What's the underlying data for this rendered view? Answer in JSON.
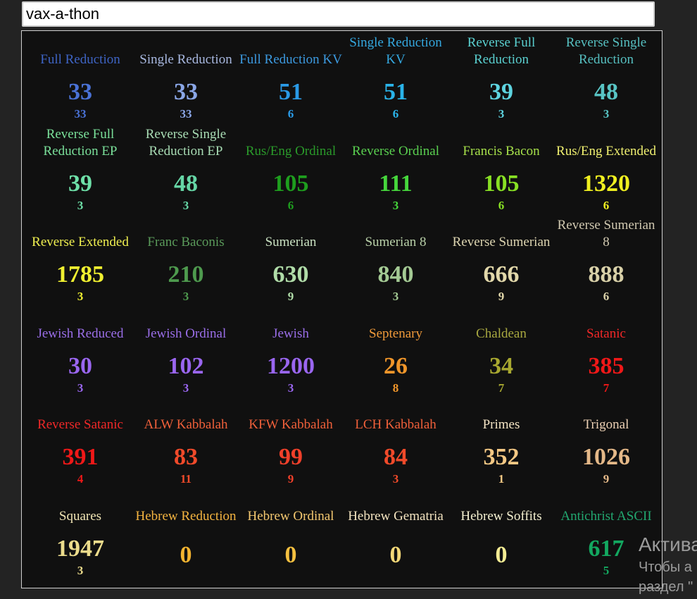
{
  "search": {
    "value": "vax-a-thon"
  },
  "ciphers": [
    {
      "name": "Full Reduction",
      "value": "33",
      "reduced": "33",
      "color": "#4a72d6"
    },
    {
      "name": "Single Reduction",
      "value": "33",
      "reduced": "33",
      "color": "#8aa6e6"
    },
    {
      "name": "Full Reduction KV",
      "value": "51",
      "reduced": "6",
      "color": "#2a9ae6"
    },
    {
      "name": "Single Reduction KV",
      "value": "51",
      "reduced": "6",
      "color": "#2ab4ea"
    },
    {
      "name": "Reverse Full Reduction",
      "value": "39",
      "reduced": "3",
      "color": "#5ed4e0"
    },
    {
      "name": "Reverse Single Reduction",
      "value": "48",
      "reduced": "3",
      "color": "#58c4c4"
    },
    {
      "name": "Reverse Full Reduction EP",
      "value": "39",
      "reduced": "3",
      "color": "#6ee0a8"
    },
    {
      "name": "Reverse Single Reduction EP",
      "value": "48",
      "reduced": "3",
      "color": "#66d6a6"
    },
    {
      "name": "Rus/Eng Ordinal",
      "value": "105",
      "reduced": "6",
      "color": "#1e9e1e"
    },
    {
      "name": "Reverse Ordinal",
      "value": "111",
      "reduced": "3",
      "color": "#46d63c"
    },
    {
      "name": "Francis Bacon",
      "value": "105",
      "reduced": "6",
      "color": "#88e024"
    },
    {
      "name": "Rus/Eng Extended",
      "value": "1320",
      "reduced": "6",
      "color": "#f0f020"
    },
    {
      "name": "Reverse Extended",
      "value": "1785",
      "reduced": "3",
      "color": "#f0f030"
    },
    {
      "name": "Franc Baconis",
      "value": "210",
      "reduced": "3",
      "color": "#4e9a4e"
    },
    {
      "name": "Sumerian",
      "value": "630",
      "reduced": "9",
      "color": "#b0dca8"
    },
    {
      "name": "Sumerian 8",
      "value": "840",
      "reduced": "3",
      "color": "#a4ca94"
    },
    {
      "name": "Reverse Sumerian",
      "value": "666",
      "reduced": "9",
      "color": "#e2d8aa"
    },
    {
      "name": "Reverse Sumerian 8",
      "value": "888",
      "reduced": "6",
      "color": "#d8d0a8"
    },
    {
      "name": "Jewish Reduced",
      "value": "30",
      "reduced": "3",
      "color": "#9a66f0"
    },
    {
      "name": "Jewish Ordinal",
      "value": "102",
      "reduced": "3",
      "color": "#9a66f0"
    },
    {
      "name": "Jewish",
      "value": "1200",
      "reduced": "3",
      "color": "#9a66f0"
    },
    {
      "name": "Septenary",
      "value": "26",
      "reduced": "8",
      "color": "#f0962a"
    },
    {
      "name": "Chaldean",
      "value": "34",
      "reduced": "7",
      "color": "#a8a830"
    },
    {
      "name": "Satanic",
      "value": "385",
      "reduced": "7",
      "color": "#f01818"
    },
    {
      "name": "Reverse Satanic",
      "value": "391",
      "reduced": "4",
      "color": "#f01818"
    },
    {
      "name": "ALW Kabbalah",
      "value": "83",
      "reduced": "11",
      "color": "#f04a2a"
    },
    {
      "name": "KFW Kabbalah",
      "value": "99",
      "reduced": "9",
      "color": "#f0402a"
    },
    {
      "name": "LCH Kabbalah",
      "value": "84",
      "reduced": "3",
      "color": "#f04a2a"
    },
    {
      "name": "Primes",
      "value": "352",
      "reduced": "1",
      "color": "#f4c884"
    },
    {
      "name": "Trigonal",
      "value": "1026",
      "reduced": "9",
      "color": "#e4b888"
    },
    {
      "name": "Squares",
      "value": "1947",
      "reduced": "3",
      "color": "#ecdc8c"
    },
    {
      "name": "Hebrew Reduction",
      "value": "0",
      "reduced": "",
      "color": "#f4b430"
    },
    {
      "name": "Hebrew Ordinal",
      "value": "0",
      "reduced": "",
      "color": "#f4c040"
    },
    {
      "name": "Hebrew Gematria",
      "value": "0",
      "reduced": "",
      "color": "#f4d878"
    },
    {
      "name": "Hebrew Soffits",
      "value": "0",
      "reduced": "",
      "color": "#f4ec94"
    },
    {
      "name": "Antichrist ASCII",
      "value": "617",
      "reduced": "5",
      "color": "#13a860"
    }
  ],
  "label_colors": {
    "Full Reduction": "#3e64c4",
    "Single Reduction": "#a8b8e0",
    "Full Reduction KV": "#3c9ae0",
    "Single Reduction KV": "#34a8e0",
    "Reverse Full Reduction": "#5ad0d0",
    "Reverse Single Reduction": "#56bfc0",
    "Reverse Full Reduction EP": "#7ae09a",
    "Reverse Single Reduction EP": "#a8dcb4",
    "Rus/Eng Ordinal": "#2a9a2a",
    "Reverse Ordinal": "#5ad050",
    "Francis Bacon": "#a6e04a",
    "Rus/Eng Extended": "#f0f070",
    "Reverse Extended": "#f0f050",
    "Franc Baconis": "#5a9a5a",
    "Sumerian": "#c8e0c0",
    "Sumerian 8": "#b8d0a8",
    "Reverse Sumerian": "#dcd4b0",
    "Reverse Sumerian 8": "#d0c8b0",
    "Jewish Reduced": "#9a6ee8",
    "Jewish Ordinal": "#9a6ee8",
    "Jewish": "#9a6ee8",
    "Septenary": "#f09a3a",
    "Chaldean": "#a8a840",
    "Satanic": "#f02828",
    "Reverse Satanic": "#f02828",
    "ALW Kabbalah": "#f0603a",
    "KFW Kabbalah": "#f0603a",
    "LCH Kabbalah": "#f0603a",
    "Primes": "#f4e4c4",
    "Trigonal": "#ecd0b4",
    "Squares": "#f0e4b4",
    "Hebrew Reduction": "#f4b440",
    "Hebrew Ordinal": "#f4c870",
    "Hebrew Gematria": "#f4e4c0",
    "Hebrew Soffits": "#f4f0d0",
    "Antichrist ASCII": "#22a870"
  },
  "watermark": {
    "title": "Актива",
    "line1": "Чтобы а",
    "line2": "раздел \""
  }
}
